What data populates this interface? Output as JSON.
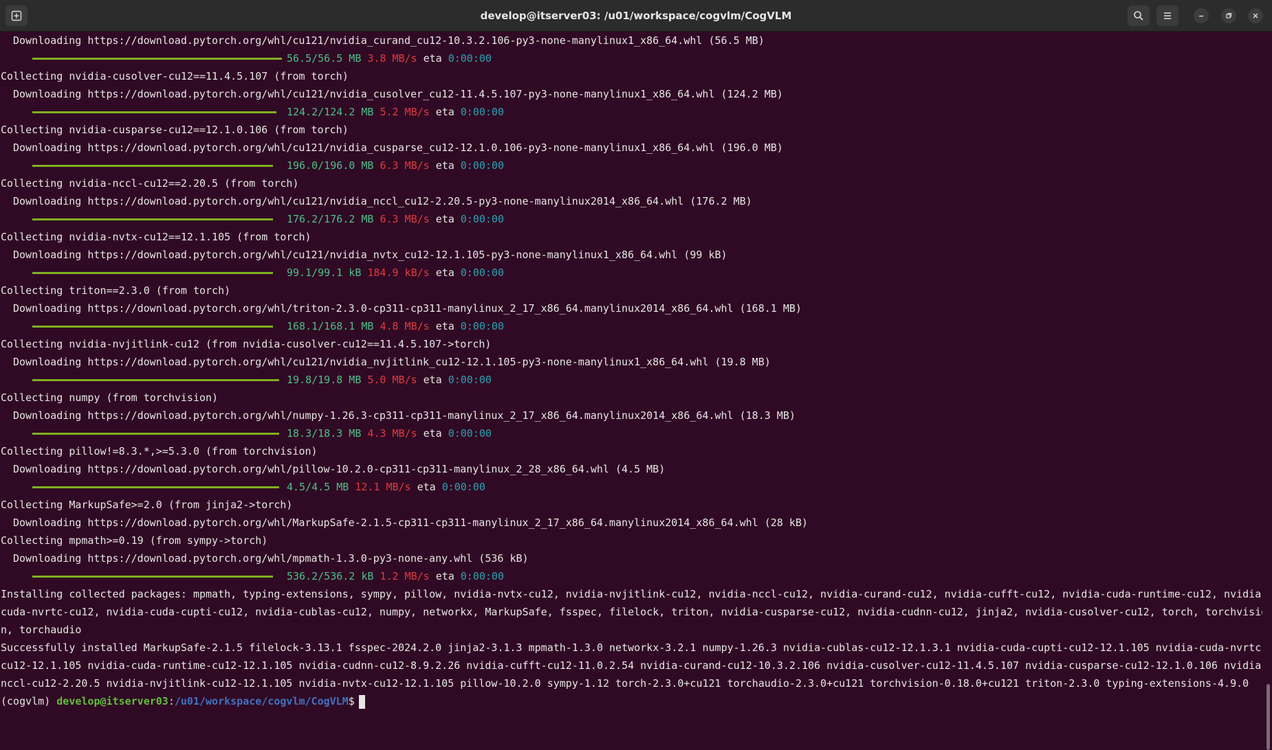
{
  "window": {
    "title": "develop@itserver03: /u01/workspace/cogvlm/CogVLM"
  },
  "icons": {
    "new_tab": "new-tab-icon",
    "search": "search-icon",
    "menu": "hamburger-menu-icon",
    "minimize": "minimize-icon",
    "restore": "restore-icon",
    "close": "close-icon"
  },
  "colors": {
    "background": "#300a24",
    "progress_done": "#4dbf88",
    "speed": "#e03a3e",
    "eta": "#2aa1b3",
    "prompt_user": "#5fbf3a",
    "prompt_path": "#3f72c2"
  },
  "lines": [
    {
      "type": "text",
      "indent": true,
      "text": "Downloading https://download.pytorch.org/whl/cu121/nvidia_curand_cu12-10.3.2.106-py3-none-manylinux1_x86_64.whl (56.5 MB)"
    },
    {
      "type": "progress",
      "bar": 363,
      "done": "56.5/56.5 MB",
      "speed": "3.8 MB/s",
      "eta_label": "eta",
      "eta": "0:00:00"
    },
    {
      "type": "text",
      "indent": false,
      "text": "Collecting nvidia-cusolver-cu12==11.4.5.107 (from torch)"
    },
    {
      "type": "text",
      "indent": true,
      "text": "Downloading https://download.pytorch.org/whl/cu121/nvidia_cusolver_cu12-11.4.5.107-py3-none-manylinux1_x86_64.whl (124.2 MB)"
    },
    {
      "type": "progress",
      "bar": 355,
      "done": "124.2/124.2 MB",
      "speed": "5.2 MB/s",
      "eta_label": "eta",
      "eta": "0:00:00"
    },
    {
      "type": "text",
      "indent": false,
      "text": "Collecting nvidia-cusparse-cu12==12.1.0.106 (from torch)"
    },
    {
      "type": "text",
      "indent": true,
      "text": "Downloading https://download.pytorch.org/whl/cu121/nvidia_cusparse_cu12-12.1.0.106-py3-none-manylinux1_x86_64.whl (196.0 MB)"
    },
    {
      "type": "progress",
      "bar": 350,
      "done": "196.0/196.0 MB",
      "speed": "6.3 MB/s",
      "eta_label": "eta",
      "eta": "0:00:00"
    },
    {
      "type": "text",
      "indent": false,
      "text": "Collecting nvidia-nccl-cu12==2.20.5 (from torch)"
    },
    {
      "type": "text",
      "indent": true,
      "text": "Downloading https://download.pytorch.org/whl/cu121/nvidia_nccl_cu12-2.20.5-py3-none-manylinux2014_x86_64.whl (176.2 MB)"
    },
    {
      "type": "progress",
      "bar": 350,
      "done": "176.2/176.2 MB",
      "speed": "6.3 MB/s",
      "eta_label": "eta",
      "eta": "0:00:00"
    },
    {
      "type": "text",
      "indent": false,
      "text": "Collecting nvidia-nvtx-cu12==12.1.105 (from torch)"
    },
    {
      "type": "text",
      "indent": true,
      "text": "Downloading https://download.pytorch.org/whl/cu121/nvidia_nvtx_cu12-12.1.105-py3-none-manylinux1_x86_64.whl (99 kB)"
    },
    {
      "type": "progress",
      "bar": 350,
      "done": "99.1/99.1 kB",
      "speed": "184.9 kB/s",
      "eta_label": "eta",
      "eta": "0:00:00"
    },
    {
      "type": "text",
      "indent": false,
      "text": "Collecting triton==2.3.0 (from torch)"
    },
    {
      "type": "text",
      "indent": true,
      "text": "Downloading https://download.pytorch.org/whl/triton-2.3.0-cp311-cp311-manylinux_2_17_x86_64.manylinux2014_x86_64.whl (168.1 MB)"
    },
    {
      "type": "progress",
      "bar": 350,
      "done": "168.1/168.1 MB",
      "speed": "4.8 MB/s",
      "eta_label": "eta",
      "eta": "0:00:00"
    },
    {
      "type": "text",
      "indent": false,
      "text": "Collecting nvidia-nvjitlink-cu12 (from nvidia-cusolver-cu12==11.4.5.107->torch)"
    },
    {
      "type": "text",
      "indent": true,
      "text": "Downloading https://download.pytorch.org/whl/cu121/nvidia_nvjitlink_cu12-12.1.105-py3-none-manylinux1_x86_64.whl (19.8 MB)"
    },
    {
      "type": "progress",
      "bar": 359,
      "done": "19.8/19.8 MB",
      "speed": "5.0 MB/s",
      "eta_label": "eta",
      "eta": "0:00:00"
    },
    {
      "type": "text",
      "indent": false,
      "text": "Collecting numpy (from torchvision)"
    },
    {
      "type": "text",
      "indent": true,
      "text": "Downloading https://download.pytorch.org/whl/numpy-1.26.3-cp311-cp311-manylinux_2_17_x86_64.manylinux2014_x86_64.whl (18.3 MB)"
    },
    {
      "type": "progress",
      "bar": 359,
      "done": "18.3/18.3 MB",
      "speed": "4.3 MB/s",
      "eta_label": "eta",
      "eta": "0:00:00"
    },
    {
      "type": "text",
      "indent": false,
      "text": "Collecting pillow!=8.3.*,>=5.3.0 (from torchvision)"
    },
    {
      "type": "text",
      "indent": true,
      "text": "Downloading https://download.pytorch.org/whl/pillow-10.2.0-cp311-cp311-manylinux_2_28_x86_64.whl (4.5 MB)"
    },
    {
      "type": "progress",
      "bar": 359,
      "done": "4.5/4.5 MB",
      "speed": "12.1 MB/s",
      "eta_label": "eta",
      "eta": "0:00:00"
    },
    {
      "type": "text",
      "indent": false,
      "text": "Collecting MarkupSafe>=2.0 (from jinja2->torch)"
    },
    {
      "type": "text",
      "indent": true,
      "text": "Downloading https://download.pytorch.org/whl/MarkupSafe-2.1.5-cp311-cp311-manylinux_2_17_x86_64.manylinux2014_x86_64.whl (28 kB)"
    },
    {
      "type": "text",
      "indent": false,
      "text": "Collecting mpmath>=0.19 (from sympy->torch)"
    },
    {
      "type": "text",
      "indent": true,
      "text": "Downloading https://download.pytorch.org/whl/mpmath-1.3.0-py3-none-any.whl (536 kB)"
    },
    {
      "type": "progress",
      "bar": 350,
      "done": "536.2/536.2 kB",
      "speed": "1.2 MB/s",
      "eta_label": "eta",
      "eta": "0:00:00"
    },
    {
      "type": "text",
      "indent": false,
      "text": "Installing collected packages: mpmath, typing-extensions, sympy, pillow, nvidia-nvtx-cu12, nvidia-nvjitlink-cu12, nvidia-nccl-cu12, nvidia-curand-cu12, nvidia-cufft-cu12, nvidia-cuda-runtime-cu12, nvidia-"
    },
    {
      "type": "text",
      "indent": false,
      "text": "cuda-nvrtc-cu12, nvidia-cuda-cupti-cu12, nvidia-cublas-cu12, numpy, networkx, MarkupSafe, fsspec, filelock, triton, nvidia-cusparse-cu12, nvidia-cudnn-cu12, jinja2, nvidia-cusolver-cu12, torch, torchvisio"
    },
    {
      "type": "text",
      "indent": false,
      "text": "n, torchaudio"
    },
    {
      "type": "text",
      "indent": false,
      "text": "Successfully installed MarkupSafe-2.1.5 filelock-3.13.1 fsspec-2024.2.0 jinja2-3.1.3 mpmath-1.3.0 networkx-3.2.1 numpy-1.26.3 nvidia-cublas-cu12-12.1.3.1 nvidia-cuda-cupti-cu12-12.1.105 nvidia-cuda-nvrtc-"
    },
    {
      "type": "text",
      "indent": false,
      "text": "cu12-12.1.105 nvidia-cuda-runtime-cu12-12.1.105 nvidia-cudnn-cu12-8.9.2.26 nvidia-cufft-cu12-11.0.2.54 nvidia-curand-cu12-10.3.2.106 nvidia-cusolver-cu12-11.4.5.107 nvidia-cusparse-cu12-12.1.0.106 nvidia-"
    },
    {
      "type": "text",
      "indent": false,
      "text": "nccl-cu12-2.20.5 nvidia-nvjitlink-cu12-12.1.105 nvidia-nvtx-cu12-12.1.105 pillow-10.2.0 sympy-1.12 torch-2.3.0+cu121 torchaudio-2.3.0+cu121 torchvision-0.18.0+cu121 triton-2.3.0 typing-extensions-4.9.0"
    }
  ],
  "prompt": {
    "env": "(cogvlm) ",
    "user": "develop@itserver03",
    "sep": ":",
    "path": "/u01/workspace/cogvlm/CogVLM",
    "symbol": "$"
  }
}
